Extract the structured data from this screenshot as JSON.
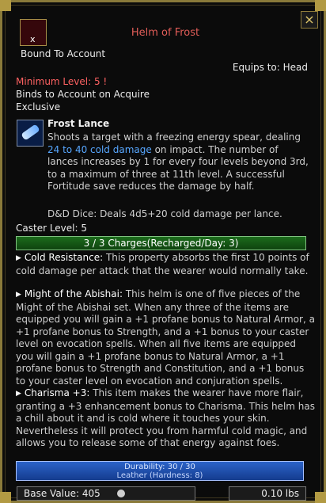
{
  "item": {
    "name": "Helm of Frost",
    "bound": "Bound To Account",
    "equips_to": "Equips to: Head",
    "minimum_level": "Minimum Level: 5 !",
    "binds": "Binds to Account on Acquire",
    "exclusive": "Exclusive"
  },
  "spell": {
    "name": "Frost Lance",
    "desc_before": "Shoots a target with a freezing energy spear, dealing ",
    "damage": "24 to 40 cold damage",
    "desc_after": " on impact. The number of lances increases by 1 for every four levels beyond 3rd, to a maximum of three at 11th level. A successful Fortitude save reduces the damage by half.",
    "dnd_dice": "D&D Dice: Deals 4d5+20 cold damage per lance."
  },
  "caster_level": "Caster Level: 5",
  "charges": "3 / 3 Charges(Recharged/Day: 3)",
  "properties": [
    {
      "name": "Cold Resistance:",
      "text": "This property absorbs the first 10 points of cold damage per attack that the wearer would normally take."
    },
    {
      "name": "Might of the Abishai:",
      "text": "This helm is one of five pieces of the Might of the Abishai set. When any three of the items are equipped you will gain a +1 profane bonus to Natural Armor, a +1 profane bonus to Strength, and a +1 bonus to your caster level on evocation spells. When all five items are equipped you will gain a +1 profane bonus to Natural Armor, a +1 profane bonus to Strength and Constitution, and a +1 bonus to your caster level on evocation and conjuration spells."
    },
    {
      "name": "Charisma +3:",
      "text": "This item makes the wearer have more flair, granting a +3 enhancement bonus to Charisma. This helm has a chill about it and is cold where it touches your skin. Nevertheless it will protect you from harmful cold magic, and allows you to release some of that energy against foes."
    }
  ],
  "durability": {
    "text": "Durability: 30 / 30",
    "material": "Leather (Hardness: 8)",
    "fraction": 1.0
  },
  "base_value": "Base Value: 405",
  "weight": "0.10 lbs",
  "icons": {
    "close": "close-icon",
    "item": "helm-icon",
    "spell": "frost-lance-icon",
    "coin": "coin-icon"
  }
}
